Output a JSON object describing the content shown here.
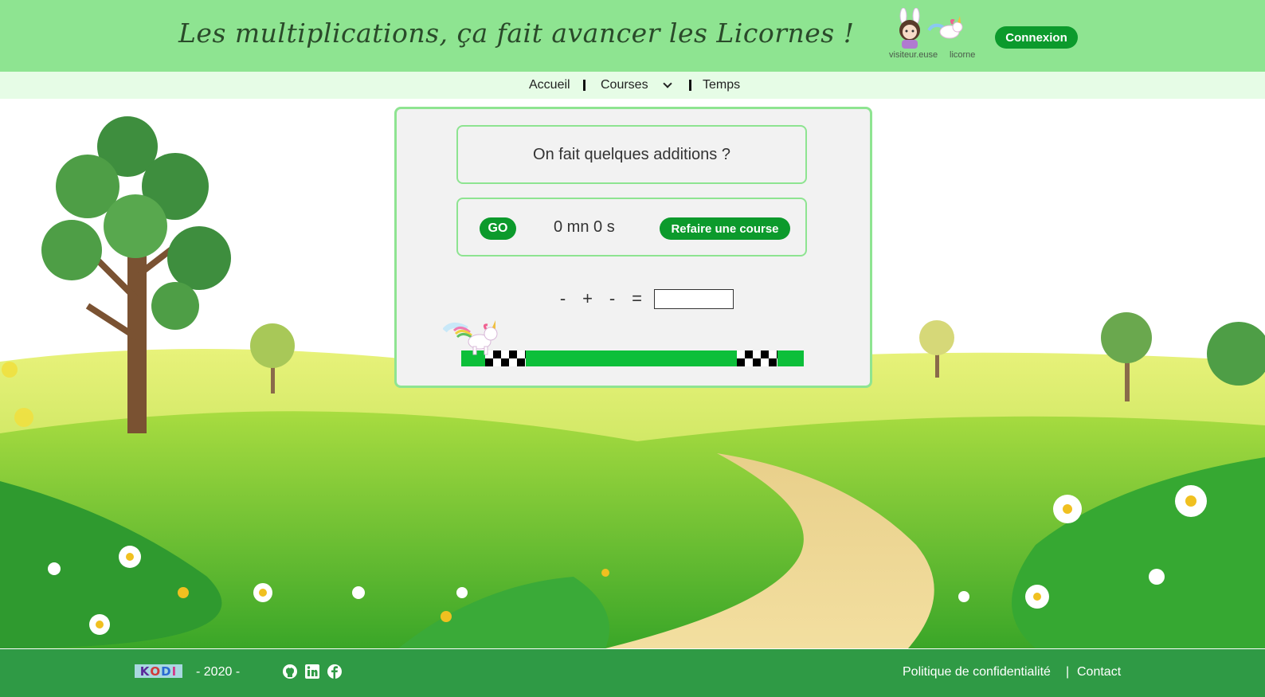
{
  "header": {
    "title": "Les multiplications, ça fait avancer les Licornes !",
    "avatars": [
      {
        "label": "visiteur.euse",
        "icon": "bunny-girl-avatar-icon"
      },
      {
        "label": "licorne",
        "icon": "unicorn-avatar-icon"
      }
    ],
    "login_label": "Connexion"
  },
  "nav": {
    "items": [
      {
        "label": "Accueil"
      },
      {
        "label": "Courses",
        "icon": "chevron-down-icon"
      },
      {
        "label": "Temps"
      }
    ]
  },
  "game": {
    "prompt": "On fait quelques additions ?",
    "go_label": "GO",
    "timer": "0 mn 0 s",
    "redo_label": "Refaire une course",
    "equation": {
      "symbols": [
        "-",
        "+",
        "-",
        "="
      ],
      "answer_value": ""
    },
    "progress": 0
  },
  "footer": {
    "logo_letters": [
      "K",
      "O",
      "D",
      "I"
    ],
    "year": "- 2020 -",
    "social_icons": [
      "github-icon",
      "linkedin-icon",
      "facebook-icon"
    ],
    "privacy_label": "Politique de confidentialité",
    "separator": "|",
    "contact_label": "Contact"
  },
  "colors": {
    "header_bg": "#8ee491",
    "nav_bg": "#e6fce6",
    "button_green": "#0c9a2c",
    "track_green": "#0dbf3a",
    "footer_bg": "#2f9a45"
  }
}
